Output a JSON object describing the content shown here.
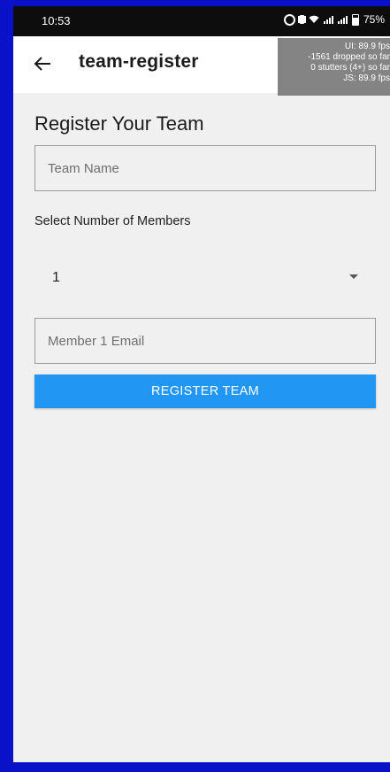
{
  "status_bar": {
    "time": "10:53",
    "battery": "75%",
    "icons": [
      "alarm-icon",
      "vibrate-icon",
      "wifi-icon",
      "signal-icon",
      "battery-icon"
    ]
  },
  "app_bar": {
    "title": "team-register",
    "back_icon": "arrow-left-icon"
  },
  "perf_overlay": {
    "ui": "UI: 89.9 fps",
    "dropped": "-1561 dropped so far",
    "stutters": "0 stutters (4+) so far",
    "js": "JS: 89.9 fps"
  },
  "form": {
    "heading": "Register Your Team",
    "team_name_placeholder": "Team Name",
    "team_name_value": "",
    "members_label": "Select Number of Members",
    "members_selected": "1",
    "member_email_placeholder": "Member 1 Email",
    "member_email_value": "",
    "submit_label": "REGISTER TEAM"
  },
  "colors": {
    "outer_frame": "#0a12c9",
    "background": "#f0f0f0",
    "button": "#2196f3",
    "status_bar": "#0d0d0d"
  }
}
